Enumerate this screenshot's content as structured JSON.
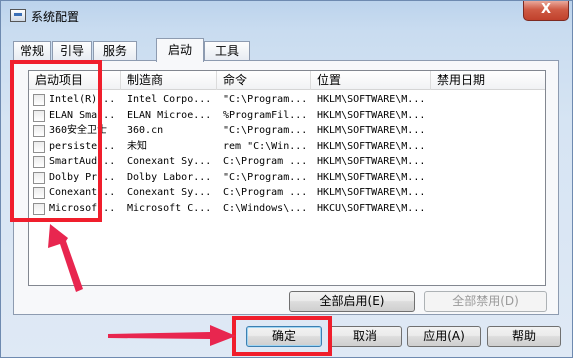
{
  "window": {
    "title": "系统配置",
    "close_label": "X"
  },
  "tabs": [
    {
      "label": "常规",
      "active": false
    },
    {
      "label": "引导",
      "active": false
    },
    {
      "label": "服务",
      "active": false
    },
    {
      "label": "启动",
      "active": true
    },
    {
      "label": "工具",
      "active": false
    }
  ],
  "table": {
    "columns": [
      "启动项目",
      "制造商",
      "命令",
      "位置",
      "禁用日期"
    ],
    "rows": [
      {
        "checked": false,
        "item": "Intel(R)...",
        "maker": "Intel Corpo...",
        "command": "\"C:\\Program...",
        "location": "HKLM\\SOFTWARE\\M...",
        "date": ""
      },
      {
        "checked": false,
        "item": "ELAN Sma...",
        "maker": "ELAN Microe...",
        "command": "%ProgramFil...",
        "location": "HKLM\\SOFTWARE\\M...",
        "date": ""
      },
      {
        "checked": false,
        "item": "360安全卫士",
        "maker": "360.cn",
        "command": "\"C:\\Program...",
        "location": "HKLM\\SOFTWARE\\M...",
        "date": ""
      },
      {
        "checked": false,
        "item": "persiste...",
        "maker": "未知",
        "command": "rem \"C:\\Win...",
        "location": "HKLM\\SOFTWARE\\M...",
        "date": ""
      },
      {
        "checked": false,
        "item": "SmartAud...",
        "maker": "Conexant Sy...",
        "command": "C:\\Program ...",
        "location": "HKLM\\SOFTWARE\\M...",
        "date": ""
      },
      {
        "checked": false,
        "item": "Dolby Pr...",
        "maker": "Dolby Labor...",
        "command": "\"C:\\Program...",
        "location": "HKLM\\SOFTWARE\\M...",
        "date": ""
      },
      {
        "checked": false,
        "item": "Conexant...",
        "maker": "Conexant Sy...",
        "command": "C:\\Program ...",
        "location": "HKLM\\SOFTWARE\\M...",
        "date": ""
      },
      {
        "checked": false,
        "item": "Microsof...",
        "maker": "Microsoft C...",
        "command": "C:\\Windows\\...",
        "location": "HKCU\\SOFTWARE\\M...",
        "date": ""
      }
    ]
  },
  "buttons": {
    "enable_all": "全部启用(E)",
    "disable_all": "全部禁用(D)",
    "ok": "确定",
    "cancel": "取消",
    "apply": "应用(A)",
    "help": "帮助"
  },
  "colors": {
    "annotation": "#f01e2c",
    "arrow": "#e8264f"
  }
}
